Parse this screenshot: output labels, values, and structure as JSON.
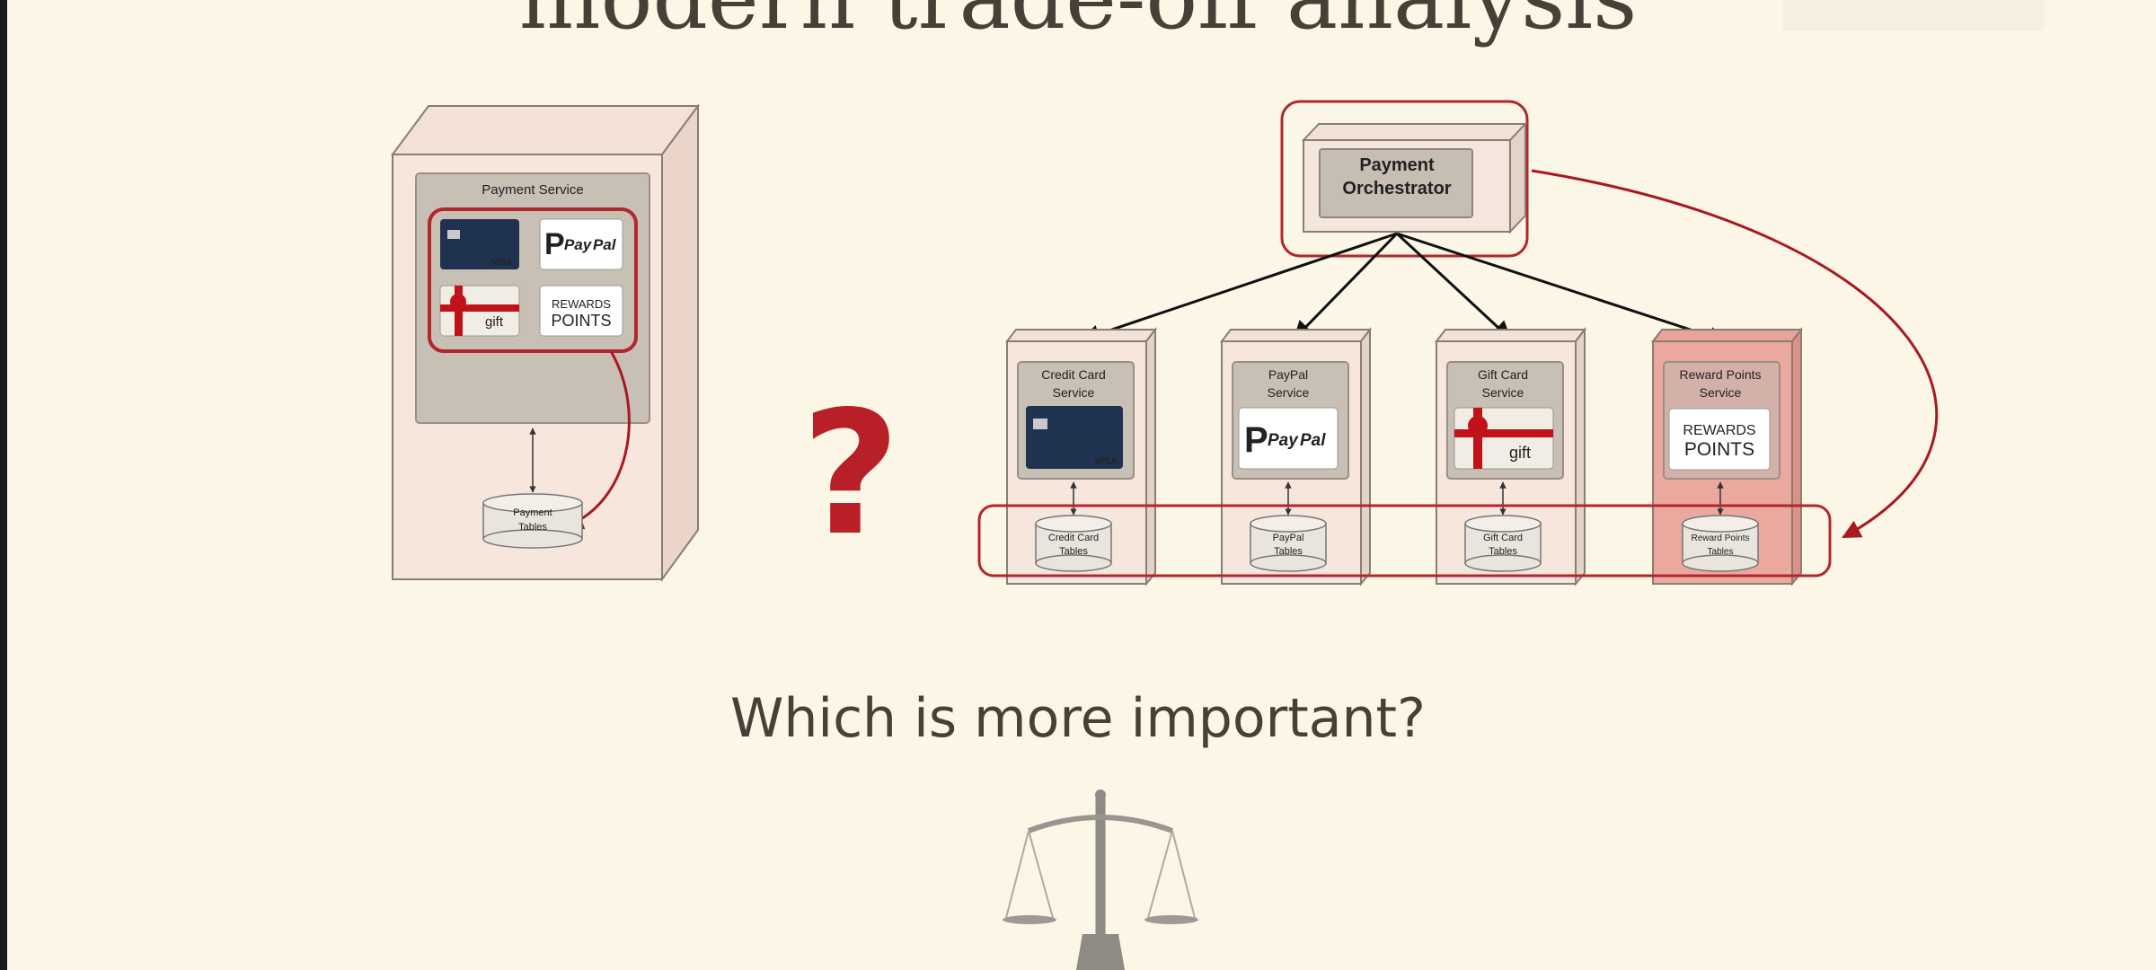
{
  "slide": {
    "title": "modern trade-off analysis",
    "question": "Which is more important?",
    "question_mark": "?"
  },
  "monolith": {
    "service_label": "Payment Service",
    "db_label_1": "Payment",
    "db_label_2": "Tables",
    "payment_methods": [
      "VISA",
      "PayPal",
      "gift card",
      "REWARDS POINTS"
    ]
  },
  "orchestrator": {
    "label_1": "Payment",
    "label_2": "Orchestrator"
  },
  "services": [
    {
      "name_1": "Credit Card",
      "name_2": "Service",
      "db_1": "Credit Card",
      "db_2": "Tables",
      "logo": "VISA"
    },
    {
      "name_1": "PayPal",
      "name_2": "Service",
      "db_1": "PayPal",
      "db_2": "Tables",
      "logo": "PayPal"
    },
    {
      "name_1": "Gift Card",
      "name_2": "Service",
      "db_1": "Gift Card",
      "db_2": "Tables",
      "logo": "gift"
    },
    {
      "name_1": "Reward Points",
      "name_2": "Service",
      "db_1": "Reward Points",
      "db_2": "Tables",
      "logo": "REWARDS POINTS"
    }
  ],
  "logo_text": {
    "visa": "VISA",
    "paypal_pay": "Pay",
    "paypal_pal": "Pal",
    "gift": "gift",
    "rewards": "REWARDS",
    "points": "POINTS"
  },
  "colors": {
    "background": "#fbf6e6",
    "highlight_red": "#b3262b",
    "highlight_fill": "#e9a9a0",
    "box_fill": "#f5e6dc",
    "inner_fill": "#c6bdb3"
  }
}
